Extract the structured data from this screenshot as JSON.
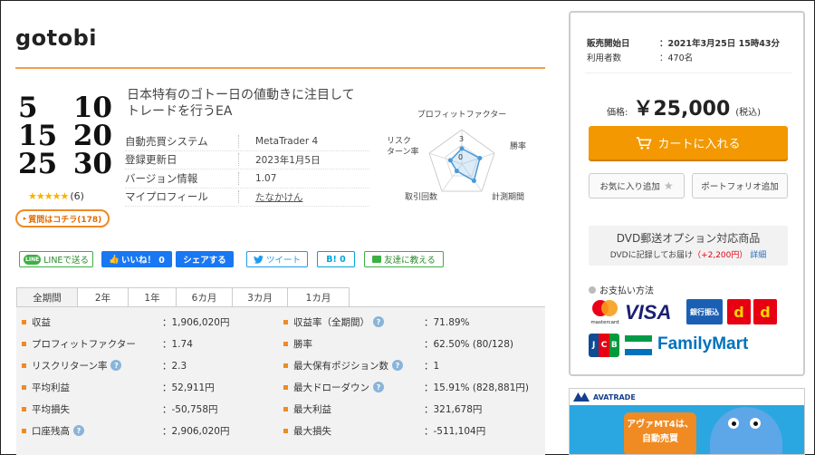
{
  "product": {
    "title": "gotobi",
    "logo_rows": [
      [
        "5",
        "10"
      ],
      [
        "15",
        "20"
      ],
      [
        "25",
        "30"
      ]
    ],
    "stars": "★★★★★",
    "review_count": "(6)",
    "qa_button": "質問はコチラ(178)",
    "description_line1": "日本特有のゴトー日の値動きに注目して",
    "description_line2": "トレードを行うEA",
    "specs": [
      {
        "label": "自動売買システム",
        "value": "MetaTrader 4"
      },
      {
        "label": "登録更新日",
        "value": "2023年1月5日"
      },
      {
        "label": "バージョン情報",
        "value": "1.07"
      },
      {
        "label": "マイプロフィール",
        "value": "たなかけん"
      }
    ]
  },
  "radar": {
    "labels": {
      "top": "プロフィットファクター",
      "right": "勝率",
      "bottom_right": "計測期間",
      "bottom_left": "取引回数",
      "left_line1": "リスク",
      "left_line2": "ターン率"
    },
    "scale_labels": [
      "3",
      "0"
    ],
    "values": [
      0.45,
      0.55,
      0.6,
      0.25,
      0.35
    ]
  },
  "social": {
    "line": "LINEで送る",
    "line_icon": "LINE",
    "like": "いいね！ 0",
    "share": "シェアする",
    "tweet": "ツイート",
    "hatena": "B! 0",
    "friend": "友達に教える"
  },
  "tabs": [
    "全期間",
    "2年",
    "1年",
    "6カ月",
    "3カ月",
    "1カ月"
  ],
  "stats_left": [
    {
      "label": "収益",
      "value": "：1,906,020円",
      "help": false
    },
    {
      "label": "プロフィットファクター",
      "value": "：1.74",
      "help": false
    },
    {
      "label": "リスクリターン率",
      "value": "：2.3",
      "help": true
    },
    {
      "label": "平均利益",
      "value": "：52,911円",
      "help": false
    },
    {
      "label": "平均損失",
      "value": "：-50,758円",
      "help": false
    },
    {
      "label": "口座残高",
      "value": "：2,906,020円",
      "help": true
    }
  ],
  "stats_right": [
    {
      "label": "収益率（全期間）",
      "value": "：71.89%",
      "help": true
    },
    {
      "label": "勝率",
      "value": "：62.50% (80/128)",
      "help": false
    },
    {
      "label": "最大保有ポジション数",
      "value": "：1",
      "help": true
    },
    {
      "label": "最大ドローダウン",
      "value": "：15.91% (828,881円)",
      "help": true
    },
    {
      "label": "最大利益",
      "value": "：321,678円",
      "help": false
    },
    {
      "label": "最大損失",
      "value": "：-511,104円",
      "help": false
    }
  ],
  "help_icon": "?",
  "sidebar": {
    "start_label": "販売開始日",
    "start_value": "：2021年3月25日 15時43分",
    "users_label": "利用者数",
    "users_value": "：470名",
    "price_label": "価格:",
    "price_value": "￥25,000",
    "tax_label": "(税込)",
    "cart_button": "カートに入れる",
    "favorite_button": "お気に入り追加",
    "portfolio_button": "ポートフォリオ追加",
    "dvd_title": "DVD郵送オプション対応商品",
    "dvd_text": "DVDに記録してお届け",
    "dvd_price": "（+2,200円）",
    "dvd_link": "詳細",
    "payment_title": "お支払い方法",
    "mastercard_label": "mastercard",
    "visa_label": "VISA",
    "bank_label": "銀行振込",
    "dpay_a": "d",
    "dpay_b": "d",
    "jcb_letters": [
      "J",
      "C",
      "B"
    ],
    "familymart_label": "FamilyMart"
  },
  "ad": {
    "brand": "AVATRADE",
    "line1": "アヴァMT4は、",
    "line2": "自動売買"
  }
}
